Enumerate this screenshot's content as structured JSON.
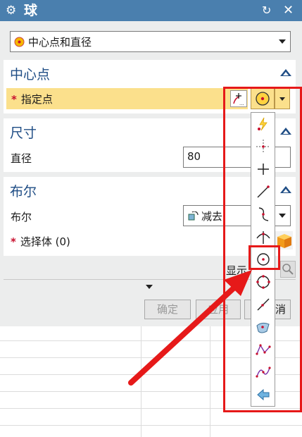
{
  "titlebar": {
    "title": "球",
    "gear_icon": "gear-icon",
    "reset_icon": "reset-icon",
    "close_icon": "close-icon"
  },
  "type_select": {
    "value": "中心点和直径"
  },
  "center": {
    "title": "中心点",
    "specify_point_label": "指定点",
    "required_mark": "*"
  },
  "size": {
    "title": "尺寸",
    "diameter_label": "直径",
    "diameter_value": "80"
  },
  "boolean": {
    "title": "布尔",
    "boolean_label": "布尔",
    "boolean_value": "减去",
    "select_body_label": "选择体 (0)",
    "required_mark": "*"
  },
  "preview": {
    "label": "显示"
  },
  "actions": {
    "ok": "确定",
    "apply": "应用",
    "cancel": "消"
  },
  "point_types": [
    "inferred-point-icon",
    "cursor-location-icon",
    "existing-point-icon",
    "end-point-icon",
    "control-point-icon",
    "intersection-point-icon",
    "arc-center-icon",
    "arc-quadrant-icon",
    "point-on-curve-icon",
    "point-on-surface-icon",
    "between-two-points-icon",
    "spline-pole-icon",
    "spline-defining-point-icon",
    "back-arrow-icon"
  ],
  "colors": {
    "titlebar": "#4a7fae",
    "section_title": "#1f4d85",
    "highlight_row": "#fbe08c",
    "annotation": "#e61919"
  }
}
